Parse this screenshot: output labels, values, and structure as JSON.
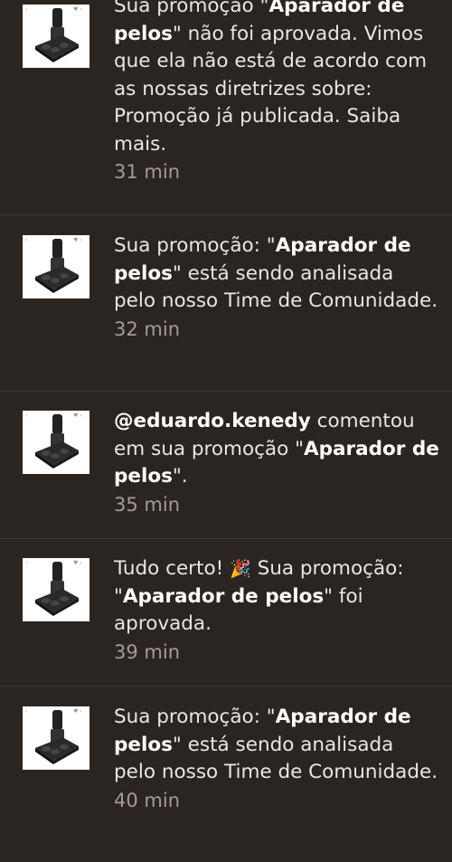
{
  "notifications": [
    {
      "pre": "Sua promoção \"",
      "bold": "Aparador de pelos",
      "post": "\" não foi aprovada. Vimos que ela não está de acordo com as nossas diretrizes sobre: Promoção já publicada. Saiba mais.",
      "time": "31 min",
      "thumb_icon": "hair-trimmer-product-icon"
    },
    {
      "pre": "Sua promoção: \"",
      "bold": "Aparador de pelos",
      "post": "\" está sendo analisada pelo nosso Time de Comunidade.",
      "time": "32 min",
      "thumb_icon": "hair-trimmer-product-icon"
    },
    {
      "user": "@eduardo.kenedy",
      "pre": " comentou em sua promoção \"",
      "bold": "Aparador de pelos",
      "post": "\".",
      "time": "35 min",
      "thumb_icon": "hair-trimmer-product-icon"
    },
    {
      "intro": "Tudo certo! ",
      "emoji": "🎉",
      "pre": " Sua promoção: \"",
      "bold": "Aparador de pelos",
      "post": "\" foi aprovada.",
      "time": "39 min",
      "thumb_icon": "hair-trimmer-product-icon"
    },
    {
      "pre": "Sua promoção: \"",
      "bold": "Aparador de pelos",
      "post": "\" está sendo analisada pelo nosso Time de Comunidade.",
      "time": "40 min",
      "thumb_icon": "hair-trimmer-product-icon"
    }
  ],
  "colors": {
    "background": "#2b2522",
    "text": "#ece6e2",
    "time": "#a39b96",
    "divider": "#3f3834"
  }
}
